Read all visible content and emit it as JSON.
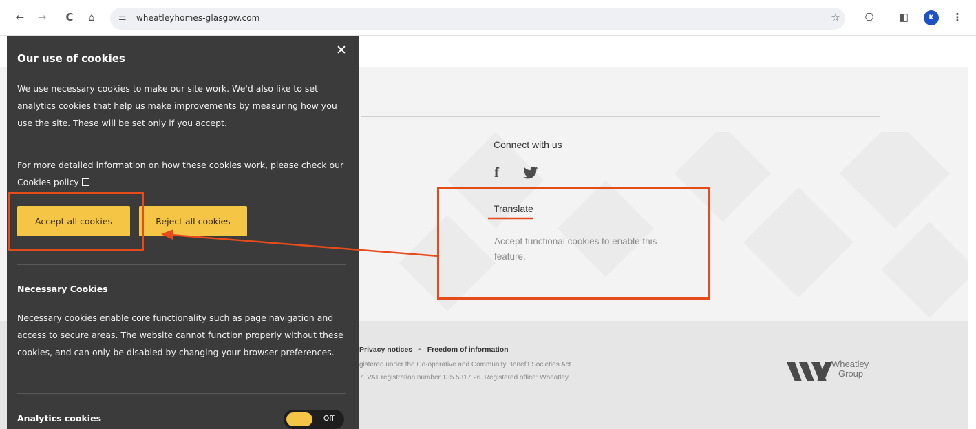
{
  "browser": {
    "url": "wheatleyhomes-glasgow.com",
    "back_icon": "←",
    "forward_icon": "→",
    "reload_icon": "C",
    "home_icon": "⌂",
    "tune_icon": "⚌",
    "star_icon": "☆",
    "extensions_icon": "⎔",
    "sidepanel_icon": "◧",
    "avatar": "K",
    "menu_icon": "⋮"
  },
  "page": {
    "connect_heading": "Connect with us",
    "facebook_glyph": "f",
    "twitter_glyph": "🐦",
    "translate_heading": "Translate",
    "translate_note": "Accept functional cookies to enable this feature.",
    "footer": {
      "privacy_link": "Privacy notices",
      "separator": "•",
      "foi_link": "Freedom of information",
      "line1": "gistered under the Co-operative and Community Benefit Societies Act",
      "line2": "7. VAT registration number 135 5317 26. Registered office: Wheatley"
    },
    "logo_text_line1": "Wheatley",
    "logo_text_line2": "Group"
  },
  "cookie_panel": {
    "title": "Our use of cookies",
    "close_icon": "✕",
    "intro": "We use necessary cookies to make our site work. We'd also like to set analytics cookies that help us make improvements by measuring how you use the site. These will be set only if you accept.",
    "more_info": "For more detailed information on how these cookies work, please check our Cookies policy",
    "accept_label": "Accept all cookies",
    "reject_label": "Reject all cookies",
    "necessary_heading": "Necessary Cookies",
    "necessary_text": "Necessary cookies enable core functionality such as page navigation and access to secure areas. The website cannot function properly without these cookies, and can only be disabled by changing your browser preferences.",
    "analytics_heading": "Analytics cookies",
    "analytics_toggle_label": "Off"
  },
  "colors": {
    "annotation": "#e64b1c",
    "button_yellow": "#f5c545",
    "panel_bg": "#3c3b3b"
  }
}
